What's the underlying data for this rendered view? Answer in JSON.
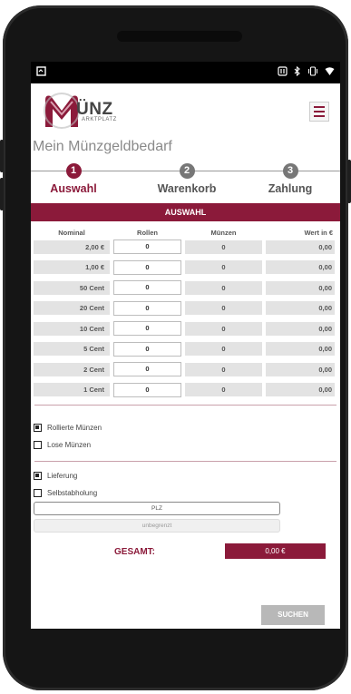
{
  "status": {
    "left_icon": "screen-rotate-icon",
    "right_icons": [
      "nfc-icon",
      "bluetooth-icon",
      "vibrate-icon",
      "wifi-icon"
    ]
  },
  "brand": {
    "name": "ÜNZ",
    "subtitle": "ARKTPLATZ",
    "color": "#8b1a3a"
  },
  "page_title": "Mein Münzgeldbedarf",
  "steps": [
    {
      "number": "1",
      "label": "Auswahl"
    },
    {
      "number": "2",
      "label": "Warenkorb"
    },
    {
      "number": "3",
      "label": "Zahlung"
    }
  ],
  "section_title": "AUSWAHL",
  "table": {
    "headers": [
      "Nominal",
      "Rollen",
      "Münzen",
      "Wert in €"
    ],
    "rows": [
      {
        "nominal": "2,00 €",
        "rollen": "0",
        "muenzen": "0",
        "wert": "0,00"
      },
      {
        "nominal": "1,00 €",
        "rollen": "0",
        "muenzen": "0",
        "wert": "0,00"
      },
      {
        "nominal": "50 Cent",
        "rollen": "0",
        "muenzen": "0",
        "wert": "0,00"
      },
      {
        "nominal": "20 Cent",
        "rollen": "0",
        "muenzen": "0",
        "wert": "0,00"
      },
      {
        "nominal": "10 Cent",
        "rollen": "0",
        "muenzen": "0",
        "wert": "0,00"
      },
      {
        "nominal": "5 Cent",
        "rollen": "0",
        "muenzen": "0",
        "wert": "0,00"
      },
      {
        "nominal": "2 Cent",
        "rollen": "0",
        "muenzen": "0",
        "wert": "0,00"
      },
      {
        "nominal": "1 Cent",
        "rollen": "0",
        "muenzen": "0",
        "wert": "0,00"
      }
    ]
  },
  "options": {
    "rollierte": "Rollierte Münzen",
    "lose": "Lose Münzen",
    "lieferung": "Lieferung",
    "selbstabholung": "Selbstabholung"
  },
  "plz_placeholder": "PLZ",
  "range_value": "unbegrenzt",
  "gesamt_label": "GESAMT:",
  "gesamt_value": "0,00 €",
  "suchen_label": "SUCHEN"
}
